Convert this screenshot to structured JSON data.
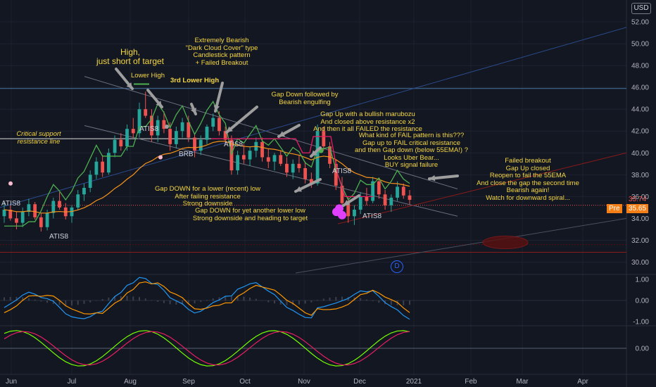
{
  "currency": "USD",
  "chart_data": {
    "type": "candlestick",
    "xlim_months": [
      "Jun",
      "Jul",
      "Aug",
      "Sep",
      "Oct",
      "Nov",
      "Dec",
      "2021",
      "Feb",
      "Mar",
      "Apr"
    ],
    "ylim": [
      29,
      54
    ],
    "y_ticks": [
      "52.00",
      "50.00",
      "48.00",
      "46.00",
      "44.00",
      "42.00",
      "40.00",
      "38.00",
      "36.00",
      "34.00",
      "32.00",
      "30.00"
    ],
    "last_price": "35.74",
    "pre_label": "Pre",
    "pre_price": "35.65",
    "osc1_ticks": [
      "1.00",
      "0.00",
      "-1.00"
    ],
    "osc2_ticks": [
      "0.00"
    ],
    "candles": [
      [
        34.2,
        35.6,
        33.6,
        34.8
      ],
      [
        34.8,
        35.2,
        33.8,
        34.0
      ],
      [
        34.0,
        34.6,
        33.0,
        33.6
      ],
      [
        33.6,
        35.0,
        33.2,
        34.6
      ],
      [
        34.6,
        35.8,
        34.2,
        35.3
      ],
      [
        35.3,
        35.5,
        33.9,
        34.1
      ],
      [
        34.1,
        34.5,
        32.8,
        33.2
      ],
      [
        33.2,
        34.8,
        32.9,
        34.5
      ],
      [
        34.5,
        35.9,
        34.0,
        35.6
      ],
      [
        35.6,
        36.4,
        34.8,
        35.0
      ],
      [
        35.0,
        35.4,
        33.9,
        34.2
      ],
      [
        34.2,
        35.2,
        33.6,
        35.0
      ],
      [
        35.0,
        36.6,
        34.8,
        36.2
      ],
      [
        36.2,
        37.2,
        35.6,
        36.8
      ],
      [
        36.8,
        38.4,
        36.4,
        38.0
      ],
      [
        38.0,
        39.6,
        37.6,
        39.2
      ],
      [
        39.2,
        39.8,
        37.8,
        38.2
      ],
      [
        38.2,
        40.4,
        38.0,
        40.0
      ],
      [
        40.0,
        41.6,
        39.6,
        41.2
      ],
      [
        41.2,
        41.8,
        40.2,
        40.6
      ],
      [
        40.6,
        42.6,
        40.2,
        42.2
      ],
      [
        42.2,
        43.2,
        41.4,
        41.8
      ],
      [
        41.8,
        44.6,
        41.4,
        44.0
      ],
      [
        44.0,
        45.6,
        43.2,
        43.4
      ],
      [
        43.4,
        44.0,
        41.0,
        41.6
      ],
      [
        41.6,
        43.4,
        41.0,
        43.0
      ],
      [
        43.0,
        43.8,
        41.8,
        42.2
      ],
      [
        42.2,
        42.8,
        40.2,
        40.8
      ],
      [
        40.8,
        42.4,
        40.4,
        42.0
      ],
      [
        42.0,
        43.2,
        41.4,
        42.8
      ],
      [
        42.8,
        43.4,
        41.0,
        41.4
      ],
      [
        41.4,
        41.8,
        39.6,
        40.2
      ],
      [
        40.2,
        41.6,
        39.8,
        41.2
      ],
      [
        41.2,
        42.6,
        40.8,
        42.4
      ],
      [
        42.4,
        43.6,
        42.0,
        43.2
      ],
      [
        43.2,
        43.8,
        41.6,
        42.0
      ],
      [
        42.0,
        42.4,
        40.8,
        41.2
      ],
      [
        41.2,
        41.6,
        38.0,
        38.4
      ],
      [
        38.4,
        40.2,
        38.0,
        39.8
      ],
      [
        39.8,
        40.8,
        39.0,
        39.4
      ],
      [
        39.4,
        40.6,
        38.8,
        40.2
      ],
      [
        40.2,
        41.4,
        39.6,
        41.0
      ],
      [
        41.0,
        41.4,
        39.2,
        39.6
      ],
      [
        39.6,
        40.4,
        38.6,
        39.2
      ],
      [
        39.2,
        40.0,
        38.4,
        39.8
      ],
      [
        39.8,
        40.2,
        38.8,
        39.0
      ],
      [
        39.0,
        39.6,
        37.8,
        38.2
      ],
      [
        38.2,
        39.4,
        37.6,
        39.0
      ],
      [
        39.0,
        39.8,
        38.2,
        38.6
      ],
      [
        38.6,
        39.2,
        37.2,
        37.6
      ],
      [
        37.6,
        38.2,
        36.8,
        37.2
      ],
      [
        37.2,
        42.6,
        37.0,
        42.0
      ],
      [
        42.0,
        42.4,
        40.2,
        40.6
      ],
      [
        40.6,
        41.0,
        38.6,
        39.0
      ],
      [
        39.0,
        39.4,
        36.6,
        37.0
      ],
      [
        37.0,
        37.8,
        35.0,
        35.4
      ],
      [
        35.4,
        36.0,
        33.6,
        34.2
      ],
      [
        34.2,
        35.2,
        33.4,
        34.8
      ],
      [
        34.8,
        36.4,
        34.4,
        36.0
      ],
      [
        36.0,
        36.8,
        35.2,
        35.6
      ],
      [
        35.6,
        37.8,
        35.4,
        37.4
      ],
      [
        37.4,
        37.6,
        35.8,
        36.2
      ],
      [
        36.2,
        36.6,
        34.8,
        35.2
      ],
      [
        35.2,
        36.2,
        34.6,
        35.9
      ],
      [
        35.9,
        37.4,
        35.6,
        36.9
      ],
      [
        36.9,
        37.2,
        35.8,
        36.1
      ],
      [
        36.1,
        36.6,
        35.3,
        35.7
      ]
    ]
  },
  "annotations": {
    "high_target": "High,\njust short of target",
    "lower_high": "Lower High",
    "third_lower_high": "3rd Lower High",
    "dark_cloud": "Extremely Bearish\n\"Dark Cloud Cover\" type\nCandlestick pattern\n+ Failed Breakout",
    "critical_support": "Critical support\nresistance line",
    "gap_down_engulfing": "Gap Down followed by\nBearish engulfing",
    "gap_up_marubozu": "Gap Up with a bullish marubozu\nAnd closed above resistance x2\nAnd then it all FAILED the resistance",
    "fail_pattern": "What kind of FAIL pattern is this???\nGap up to FAIL critical resistance\nand then Gap down (below 55EMA!) ?\nLooks Uber Bear...\nBUY signal failure",
    "failed_breakout": "Failed breakout\nGap Up closed\nReopen to fail the 55EMA\nAnd close the gap the second time\nBearish again!\nWatch for downward spiral...",
    "gap_down_recent_low": "Gap DOWN for a lower (recent) low\nAfter failing resistance\nStrong downside",
    "gap_down_lower_low": "Gap DOWN for yet another lower low\nStrong downside and heading to target"
  },
  "markers": {
    "atis_labels": [
      "ATIS8",
      "ATIS8",
      "ATIS8",
      "ATIS8",
      "ATIS8",
      "ATIS8"
    ],
    "brb": "BRB",
    "d_badge": "D"
  },
  "colors": {
    "background": "#131722",
    "bull": "#26a69a",
    "bear": "#ef5350",
    "annotation": "#f5d742",
    "ema": "#f7931a",
    "pre": "#f57f17"
  }
}
